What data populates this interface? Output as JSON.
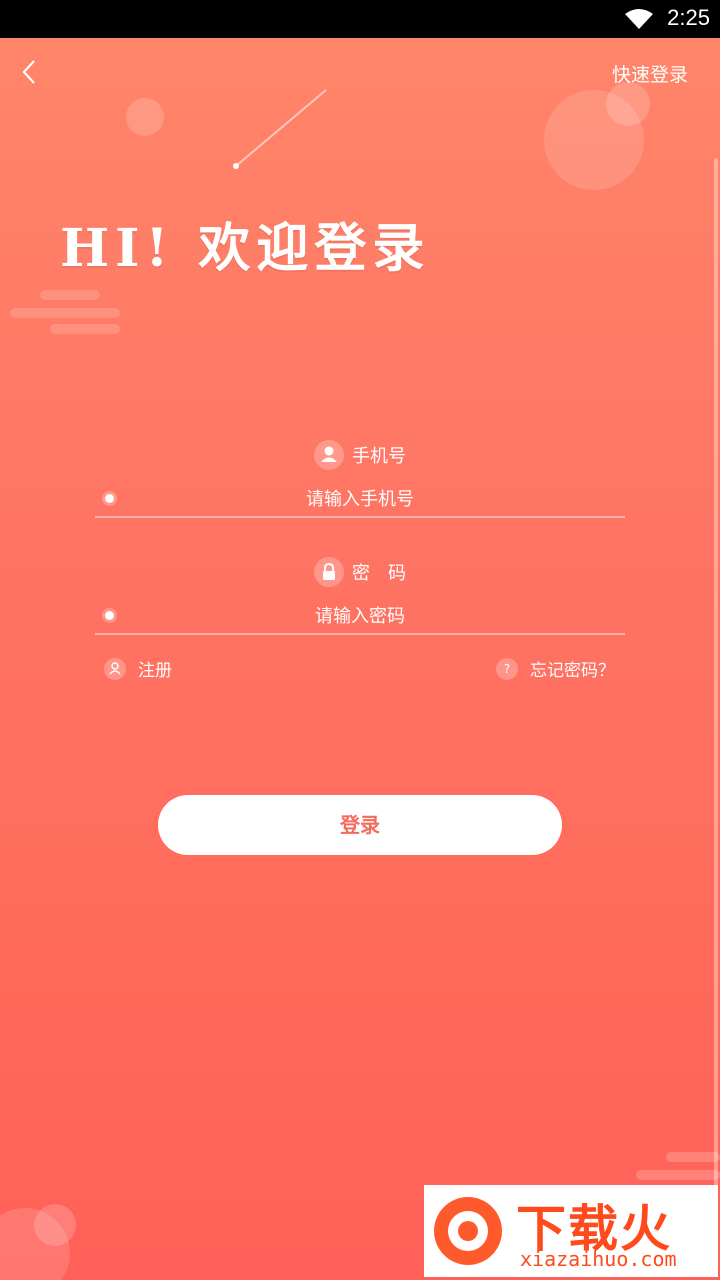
{
  "status_bar": {
    "time": "2:25"
  },
  "header": {
    "quick_login": "快速登录"
  },
  "headline": "HI!  欢迎登录",
  "form": {
    "phone": {
      "label": "手机号",
      "placeholder": "请输入手机号"
    },
    "password": {
      "label": "密　码",
      "placeholder": "请输入密码"
    },
    "register": "注册",
    "forgot": "忘记密码？",
    "submit": "登录"
  },
  "watermark": {
    "brand": "下载火",
    "domain": "xiazaihuo.com"
  },
  "colors": {
    "gradient_top": "#ff8569",
    "gradient_bottom": "#ff6059",
    "button_text": "#f46a5c"
  }
}
